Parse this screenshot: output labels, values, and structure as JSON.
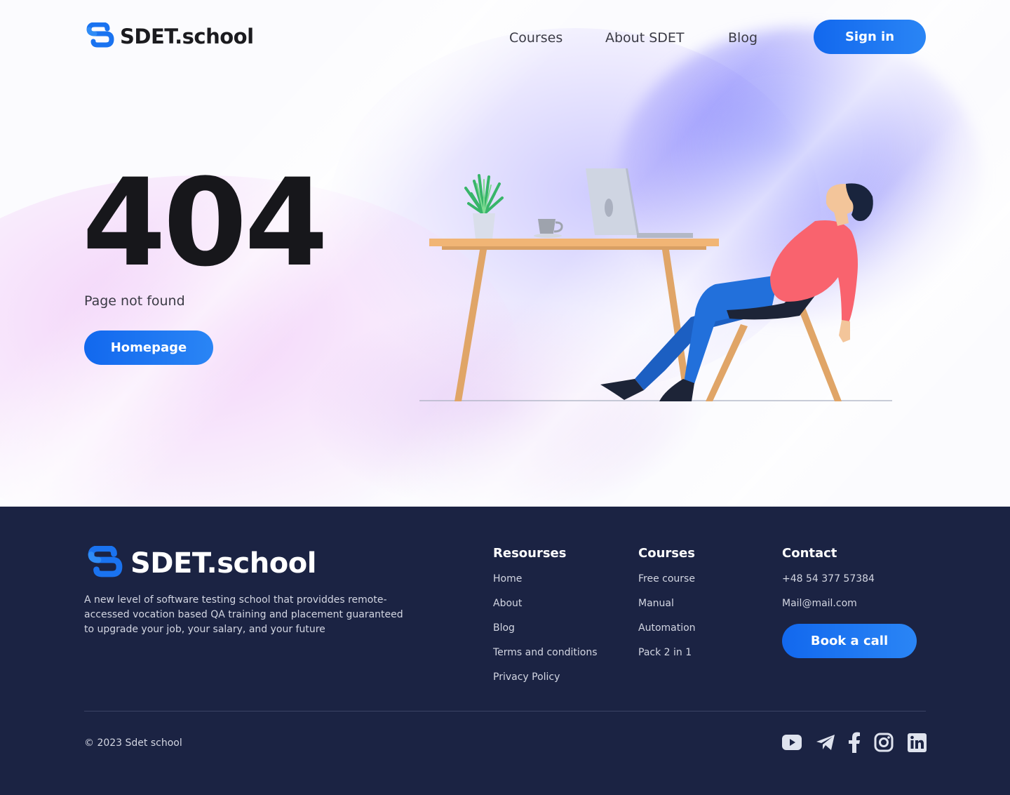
{
  "brand": {
    "name": "SDET.school",
    "accent": "#1a73f0",
    "footer_bg": "#1b2343"
  },
  "header": {
    "nav": [
      {
        "label": "Courses"
      },
      {
        "label": "About SDET"
      },
      {
        "label": "Blog"
      }
    ],
    "signin_label": "Sign in"
  },
  "main": {
    "error_code": "404",
    "message": "Page not found",
    "home_button_label": "Homepage",
    "illustration": "person-reclining-at-desk-with-laptop"
  },
  "footer": {
    "brand_name": "SDET.school",
    "description": "A new level of software testing school that providdes remote-accessed vocation based QA training and placement guaranteed to upgrade your job, your salary, and your future",
    "columns": [
      {
        "title": "Resourses",
        "links": [
          "Home",
          "About",
          "Blog",
          "Terms and conditions",
          "Privacy Policy"
        ]
      },
      {
        "title": "Courses",
        "links": [
          "Free course",
          "Manual",
          "Automation",
          "Pack 2 in 1"
        ]
      },
      {
        "title": "Contact",
        "links": [
          "+48 54 377 57384",
          "Mail@mail.com"
        ]
      }
    ],
    "book_call_label": "Book a call",
    "copyright": "© 2023 Sdet school",
    "social_icons": [
      "youtube-icon",
      "telegram-icon",
      "facebook-icon",
      "instagram-icon",
      "linkedin-icon"
    ]
  }
}
